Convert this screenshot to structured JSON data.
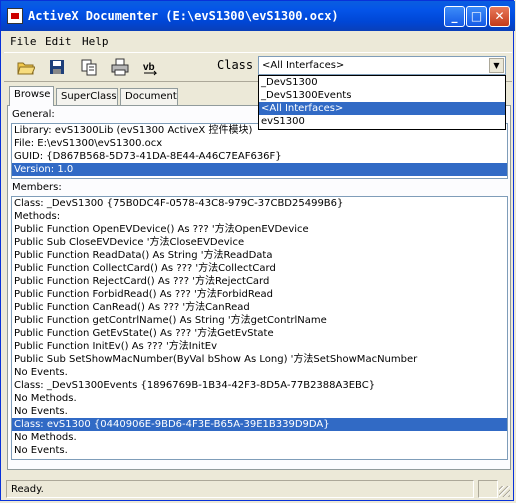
{
  "window": {
    "title": "ActiveX Documenter (E:\\evS1300\\evS1300.ocx)"
  },
  "menu": [
    "File",
    "Edit",
    "Help"
  ],
  "toolbar": {
    "class_label": "Class",
    "class_value": "<All Interfaces>",
    "vb_label": "vb"
  },
  "class_dropdown": {
    "items": [
      "_DevS1300",
      "_DevS1300Events",
      "<All Interfaces>",
      "evS1300"
    ],
    "selected": "<All Interfaces>"
  },
  "tabs": [
    "Browse",
    "SuperClass",
    "Document"
  ],
  "active_tab": "Browse",
  "general": {
    "label": "General:",
    "lines": [
      "Library:   evS1300Lib (evS1300 ActiveX 控件模块)",
      "File:        E:\\evS1300\\evS1300.ocx",
      "GUID:      {D867B568-5D73-41DA-8E44-A46C7EAF636F}",
      "Version:  1.0"
    ],
    "selected_index": 3
  },
  "members": {
    "label": "Members:",
    "lines": [
      "Class:      _DevS1300 {75B0DC4F-0578-43C8-979C-37CBD25499B6}",
      "Methods:",
      "Public Function OpenEVDevice() As ??? '方法OpenEVDevice",
      "Public Sub CloseEVDevice '方法CloseEVDevice",
      "Public Function ReadData() As String '方法ReadData",
      "Public Function CollectCard() As ??? '方法CollectCard",
      "Public Function RejectCard() As ??? '方法RejectCard",
      "Public Function ForbidRead() As ??? '方法ForbidRead",
      "Public Function CanRead() As ??? '方法CanRead",
      "Public Function getContrlName() As String '方法getContrlName",
      "Public Function GetEvState() As ??? '方法GetEvState",
      "Public Function InitEv() As ??? '方法InitEv",
      "Public Sub SetShowMacNumber(ByVal bShow As Long) '方法SetShowMacNumber",
      "No Events.",
      "Class:      _DevS1300Events {1896769B-1B34-42F3-8D5A-77B2388A3EBC}",
      "No Methods.",
      "No Events.",
      "Class:      evS1300 {0440906E-9BD6-4F3E-B65A-39E1B339D9DA}",
      "No Methods.",
      "No Events."
    ],
    "selected_index": 17
  },
  "status": {
    "text": "Ready."
  }
}
